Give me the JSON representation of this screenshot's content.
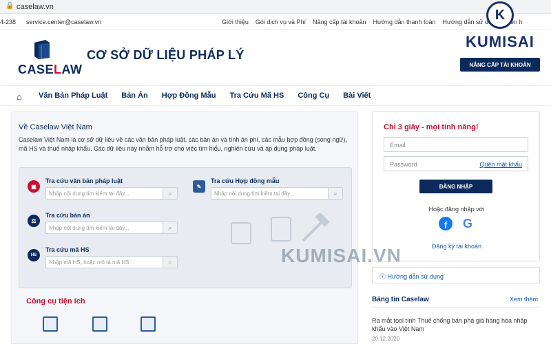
{
  "browser": {
    "url": "caselaw.vn"
  },
  "topbar": {
    "phone": "4-238",
    "email": "service.center@caselaw.vn",
    "links": [
      "Giới thiệu",
      "Gói dịch vụ và Phí",
      "Nâng cấp tài khoản",
      "Hướng dẫn thanh toán",
      "Hướng dẫn sử dụng",
      "Liên h"
    ]
  },
  "header": {
    "logo_left": "CASE",
    "logo_right": "AW",
    "site_title": "CƠ SỞ DỮ LIỆU PHÁP LÝ",
    "upgrade_button": "NÂNG CẤP TÀI KHOẢN"
  },
  "watermark": {
    "logo_letter": "K",
    "logo_text": "KUMISAI",
    "center_text": "KUMISAI.VN"
  },
  "nav": {
    "items": [
      "Văn Bản Pháp Luật",
      "Bản Án",
      "Hợp Đồng Mẫu",
      "Tra Cứu Mã HS",
      "Công Cụ",
      "Bài Viết"
    ]
  },
  "about": {
    "title": "Về Caselaw Việt Nam",
    "text": "Caselaw Việt Nam là cơ sở dữ liệu về các văn bản pháp luật, các bản án và tính án phí, các mẫu hợp đồng (song ngữ), mã HS và thuế nhập khẩu. Các dữ liệu này nhằm hỗ trợ cho việc tìm hiểu, nghiên cứu và áp dụng pháp luật."
  },
  "search": {
    "legal_docs": {
      "label": "Tra cứu văn bản pháp luật",
      "placeholder": "Nhập nội dung tìm kiếm tại đây..."
    },
    "contracts": {
      "label": "Tra cứu Hợp đồng mẫu",
      "placeholder": "Nhập nội dung tìm kiếm tại đây..."
    },
    "judgments": {
      "label": "Tra cứu bản án",
      "placeholder": "Nhập nội dung tìm kiếm tại đây..."
    },
    "hs_code": {
      "label": "Tra cứu mã HS",
      "placeholder": "Nhập mã HS, hoặc mô tả mã HS",
      "icon_text": "HS"
    }
  },
  "tools": {
    "title": "Công cụ tiện ích"
  },
  "login": {
    "title": "Chỉ 3 giây - mọi tính năng!",
    "email_placeholder": "Email",
    "password_placeholder": "Password",
    "forgot": "Quên mật khẩu",
    "button": "ĐĂNG NHẬP",
    "or_text": "Hoặc đăng nhập với",
    "facebook_letter": "f",
    "google_letter": "G",
    "register": "Đăng ký tài khoản"
  },
  "guide": {
    "label": "Hướng dẫn sử dụng"
  },
  "news": {
    "title": "Bảng tin Caselaw",
    "more": "Xem thêm",
    "item": "Ra mắt tool tính Thuế chống bán phá giá hàng hóa nhập khẩu vào Việt Nam",
    "date": "20.12.2020"
  },
  "colors": {
    "brand_navy": "#0b2a5b",
    "accent_red": "#c8102e",
    "link_blue": "#1a5cb0"
  }
}
